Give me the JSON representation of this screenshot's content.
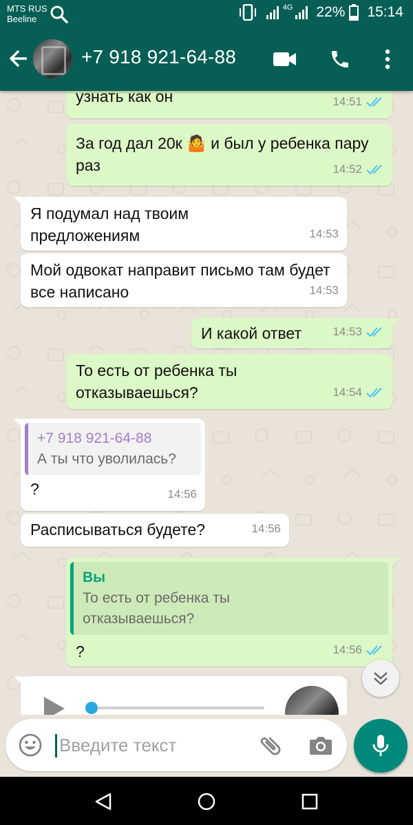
{
  "status_bar": {
    "carrier_1": "MTS RUS",
    "carrier_2": "Beeline",
    "network": "4G",
    "battery": "22%",
    "time": "15:14"
  },
  "header": {
    "title": "+7 918 921-64-88"
  },
  "messages": [
    {
      "dir": "out",
      "text": "узнать как он",
      "time": "14:51",
      "ticks": "read"
    },
    {
      "dir": "out",
      "text": "За год дал 20к 🤷 и был у ребенка пару раз",
      "time": "14:52",
      "ticks": "read"
    },
    {
      "dir": "in",
      "text": "Я подумал над твоим предложениям",
      "time": "14:53"
    },
    {
      "dir": "in",
      "text": "Мой одвокат направит письмо там будет все написано",
      "time": "14:53"
    },
    {
      "dir": "out",
      "text": "И какой ответ",
      "time": "14:53",
      "ticks": "read"
    },
    {
      "dir": "out",
      "text": "То есть от ребенка ты отказываешься?",
      "time": "14:54",
      "ticks": "read"
    },
    {
      "dir": "in",
      "quote_author": "+7 918 921-64-88",
      "quote_text": "А ты что уволилась?",
      "text": "?",
      "time": "14:56"
    },
    {
      "dir": "in",
      "text": "Расписываться будете?",
      "time": "14:56"
    },
    {
      "dir": "out",
      "quote_author": "Вы",
      "quote_text": "То есть от ребенка ты отказываешься?",
      "text": "?",
      "time": "14:56",
      "ticks": "read"
    }
  ],
  "colors": {
    "brand": "#075e54",
    "outgoing_bubble": "#dcf8c6",
    "incoming_bubble": "#ffffff",
    "read_ticks": "#4fc3f7",
    "mic_button": "#00897b"
  },
  "composer": {
    "placeholder": "Введите текст"
  },
  "icons": [
    "search-icon",
    "back-arrow-icon",
    "video-call-icon",
    "phone-icon",
    "more-vert-icon",
    "emoji-icon",
    "attach-icon",
    "camera-icon",
    "mic-icon",
    "scroll-down-icon",
    "play-icon",
    "nav-back-icon",
    "nav-home-icon",
    "nav-recent-icon"
  ]
}
